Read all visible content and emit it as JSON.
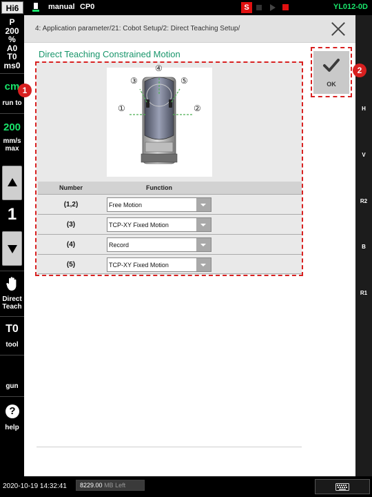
{
  "topbar": {
    "brand": "Hi6",
    "mode": "manual",
    "cp": "CP0",
    "status_badge": "S",
    "robot_id": "YL012-0D"
  },
  "leftbar": {
    "status_lines": [
      "P",
      "200",
      "%",
      "A0",
      "T0",
      "ms0"
    ],
    "coord": "cm",
    "run_to": "run to",
    "speed_value": "200",
    "speed_unit": "mm/s",
    "speed_max": "max",
    "step": "1",
    "direct_teach_1": "Direct",
    "direct_teach_2": "Teach",
    "tool_value": "T0",
    "tool_label": "tool",
    "gun_label": "gun",
    "help_label": "help"
  },
  "rightbar": {
    "labels": [
      "H",
      "V",
      "R2",
      "B",
      "R1"
    ]
  },
  "header": {
    "breadcrumb": "4: Application parameter/21: Cobot Setup/2: Direct Teaching Setup/"
  },
  "page": {
    "title": "Direct Teaching Constrained Motion",
    "ok_label": "OK"
  },
  "diagram": {
    "markers": [
      "①",
      "②",
      "③",
      "④",
      "⑤"
    ]
  },
  "table": {
    "headers": {
      "number": "Number",
      "function": "Function"
    },
    "rows": [
      {
        "number": "(1,2)",
        "function": "Free Motion"
      },
      {
        "number": "(3)",
        "function": "TCP-XY Fixed Motion"
      },
      {
        "number": "(4)",
        "function": "Record"
      },
      {
        "number": "(5)",
        "function": "TCP-XY Fixed Motion"
      }
    ]
  },
  "callouts": [
    "1",
    "2"
  ],
  "bottombar": {
    "datetime": "2020-10-19 14:32:41",
    "memory_value": "8229.00",
    "memory_suffix": "MB Left"
  },
  "colors": {
    "accent_green": "#17956a",
    "status_green": "#19e66b",
    "callout_red": "#d82020"
  }
}
